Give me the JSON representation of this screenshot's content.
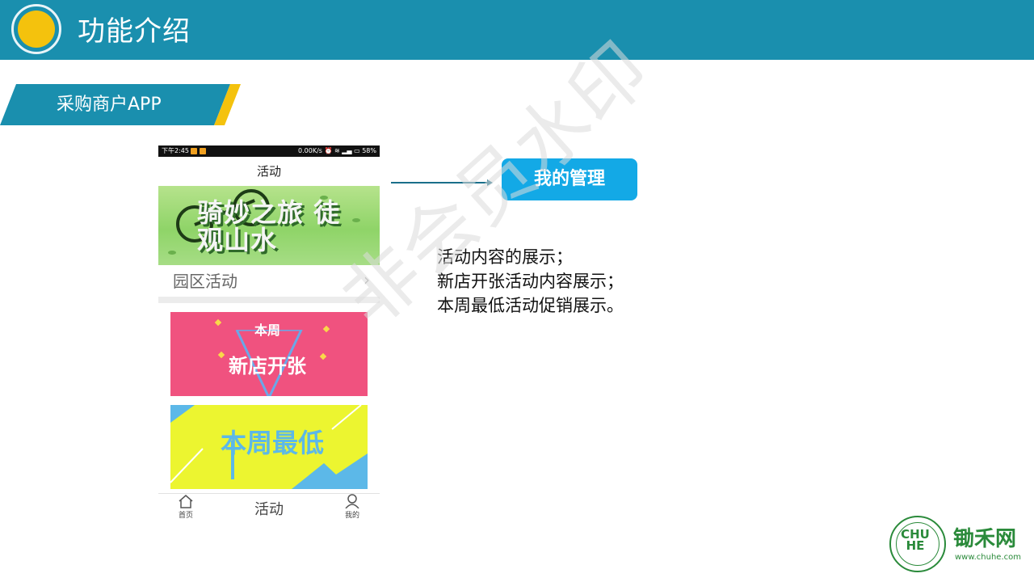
{
  "header": {
    "title": "功能介绍"
  },
  "section": {
    "label": "采购商户APP"
  },
  "phone": {
    "status": {
      "time": "下午2:45",
      "network": "0.00K/s",
      "battery": "58%"
    },
    "title": "活动",
    "banner1": {
      "text": "骑妙之旅 徒观山水"
    },
    "park_row": {
      "label": "园区活动",
      "chevron": "›"
    },
    "banner2": {
      "top_text": "本周",
      "main_text": "新店开张"
    },
    "banner3": {
      "text": "本周最低"
    },
    "tabs": [
      {
        "label": "首页",
        "icon": "home-icon"
      },
      {
        "label": "活动",
        "icon": ""
      },
      {
        "label": "我的",
        "icon": "user-icon"
      }
    ]
  },
  "callout": {
    "label": "我的管理"
  },
  "description": {
    "lines": [
      "活动内容的展示；",
      "新店开张活动内容展示；",
      "本周最低活动促销展示。"
    ]
  },
  "watermark": "非会员水印",
  "brand": {
    "name": "锄禾网",
    "url": "www.chuhe.com",
    "seal_text": "CHU HE"
  },
  "colors": {
    "header": "#1a8fae",
    "accent": "#f4c20d",
    "callout": "#13a9e6",
    "brand": "#2a8a3a"
  }
}
